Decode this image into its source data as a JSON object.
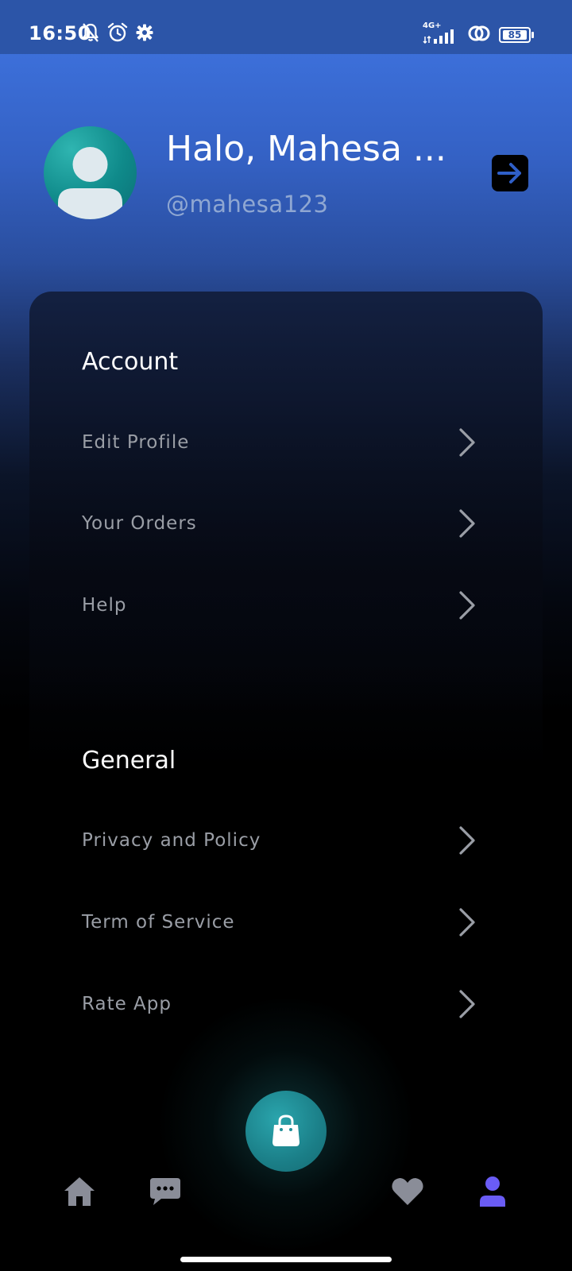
{
  "status_bar": {
    "time": "16:50",
    "network_type": "4G+",
    "battery_level": "85",
    "icons_left": [
      "bell-off-icon",
      "alarm-icon",
      "settings-gear-icon"
    ],
    "icons_right": [
      "signal-icon",
      "hotspot-link-icon",
      "battery-icon"
    ]
  },
  "profile": {
    "greeting": "Halo, Mahesa ...",
    "username": "@mahesa123",
    "avatar_icon": "default-user-avatar-icon",
    "logout_icon": "logout-arrow-icon"
  },
  "sections": [
    {
      "title": "Account",
      "items": [
        {
          "label": "Edit Profile",
          "icon": "chevron-right-icon"
        },
        {
          "label": "Your Orders",
          "icon": "chevron-right-icon"
        },
        {
          "label": "Help",
          "icon": "chevron-right-icon"
        }
      ]
    },
    {
      "title": "General",
      "items": [
        {
          "label": "Privacy and Policy",
          "icon": "chevron-right-icon"
        },
        {
          "label": "Term of Service",
          "icon": "chevron-right-icon"
        },
        {
          "label": "Rate App",
          "icon": "chevron-right-icon"
        }
      ]
    }
  ],
  "bottom_nav": {
    "items": [
      {
        "name": "home",
        "icon": "home-icon",
        "active": false
      },
      {
        "name": "chat",
        "icon": "chat-bubble-icon",
        "active": false
      },
      {
        "name": "shop",
        "icon": "shopping-bag-icon",
        "active": false
      },
      {
        "name": "wishlist",
        "icon": "heart-icon",
        "active": false
      },
      {
        "name": "profile",
        "icon": "user-icon",
        "active": true
      }
    ],
    "colors": {
      "inactive": "#8a8d98",
      "active": "#6a5cf5",
      "fab": "#1f8f98"
    }
  },
  "colors": {
    "header_blue": "#3c6fd9",
    "status_bar": "#2c55a8",
    "menu_text": "#9a9ea6",
    "username_text": "#8fa7d2"
  }
}
